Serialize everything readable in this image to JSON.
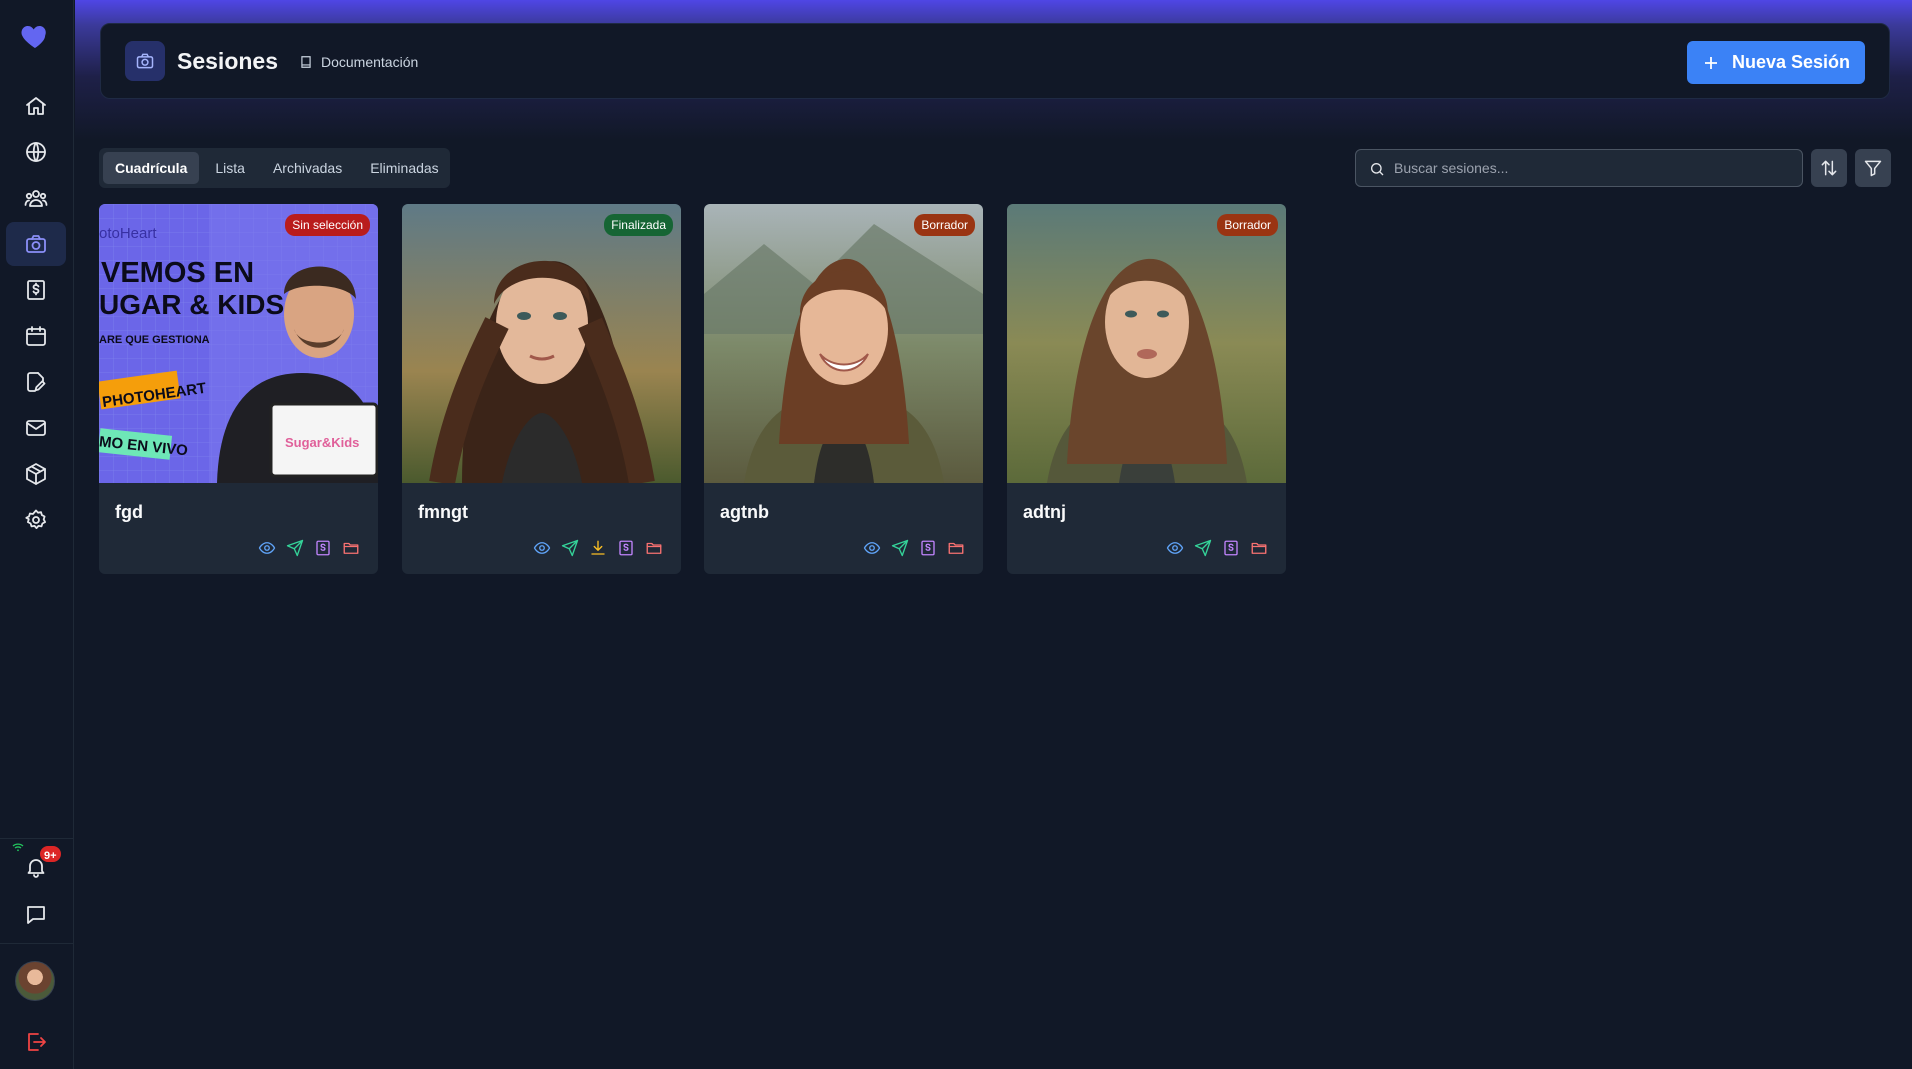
{
  "sidebar": {
    "logo": "heart-logo",
    "items": [
      {
        "name": "home-icon"
      },
      {
        "name": "globe-icon"
      },
      {
        "name": "clients-icon"
      },
      {
        "name": "camera-icon",
        "active": true
      },
      {
        "name": "invoice-icon"
      },
      {
        "name": "calendar-icon"
      },
      {
        "name": "edit-icon"
      },
      {
        "name": "mail-icon"
      },
      {
        "name": "package-icon"
      },
      {
        "name": "settings-icon"
      }
    ],
    "notifications_badge": "9+"
  },
  "header": {
    "title": "Sesiones",
    "doc_link": "Documentación",
    "new_button": "Nueva Sesión"
  },
  "tabs": [
    {
      "label": "Cuadrícula",
      "active": true
    },
    {
      "label": "Lista"
    },
    {
      "label": "Archivadas"
    },
    {
      "label": "Eliminadas"
    }
  ],
  "search": {
    "placeholder": "Buscar sesiones..."
  },
  "sessions": [
    {
      "name": "fgd",
      "status": "Sin selección",
      "status_color": "#b91c1c",
      "thumb_text": [
        "otoHeart",
        "VEMOS EN",
        "UGAR & KIDS",
        "ARE QUE GESTIONA",
        "PHOTOHEART",
        "MO EN VIVO",
        "Sugar&Kids"
      ],
      "actions": [
        "view-icon",
        "send-icon",
        "invoice-icon",
        "folder-icon"
      ]
    },
    {
      "name": "fmngt",
      "status": "Finalizada",
      "status_color": "#166534",
      "actions": [
        "view-icon",
        "send-icon",
        "download-icon",
        "invoice-icon",
        "folder-icon"
      ]
    },
    {
      "name": "agtnb",
      "status": "Borrador",
      "status_color": "#9a3412",
      "actions": [
        "view-icon",
        "send-icon",
        "invoice-icon",
        "folder-icon"
      ]
    },
    {
      "name": "adtnj",
      "status": "Borrador",
      "status_color": "#9a3412",
      "actions": [
        "view-icon",
        "send-icon",
        "invoice-icon",
        "folder-icon"
      ]
    }
  ],
  "colors": {
    "accent": "#3b82f6",
    "bg": "#111827",
    "card": "#1f2937"
  }
}
